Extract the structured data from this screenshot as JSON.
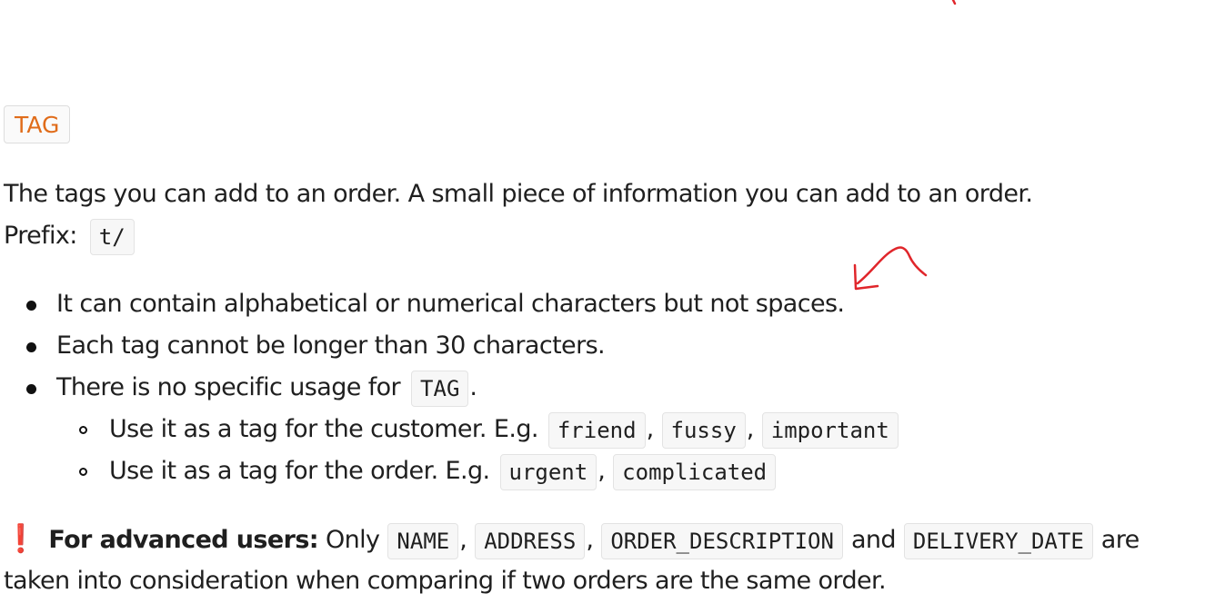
{
  "section": {
    "tag_label": "TAG",
    "description": "The tags you can add to an order. A small piece of information you can add to an order.",
    "prefix_label": "Prefix:",
    "prefix_code": "t/"
  },
  "rules": [
    {
      "text": "It can contain alphabetical or numerical characters but not spaces."
    },
    {
      "text": "Each tag cannot be longer than 30 characters."
    },
    {
      "text_before": "There is no specific usage for",
      "code": "TAG",
      "text_after": "."
    }
  ],
  "sub_rules": [
    {
      "text": "Use it as a tag for the customer. E.g.",
      "examples": [
        "friend",
        "fussy",
        "important"
      ]
    },
    {
      "text": "Use it as a tag for the order. E.g.",
      "examples": [
        "urgent",
        "complicated"
      ]
    }
  ],
  "note": {
    "icon": "exclamation-icon",
    "icon_glyph": "❗",
    "bold": "For advanced users:",
    "text_only": "Only",
    "fields": [
      "NAME",
      "ADDRESS",
      "ORDER_DESCRIPTION",
      "DELIVERY_DATE"
    ],
    "sep": ",",
    "and": "and",
    "are": "are",
    "line2": "taken into consideration when comparing if two orders are the same order."
  },
  "colors": {
    "tag_accent": "#e06c1a",
    "warning": "#e0262b",
    "annotation": "#e0262b"
  }
}
